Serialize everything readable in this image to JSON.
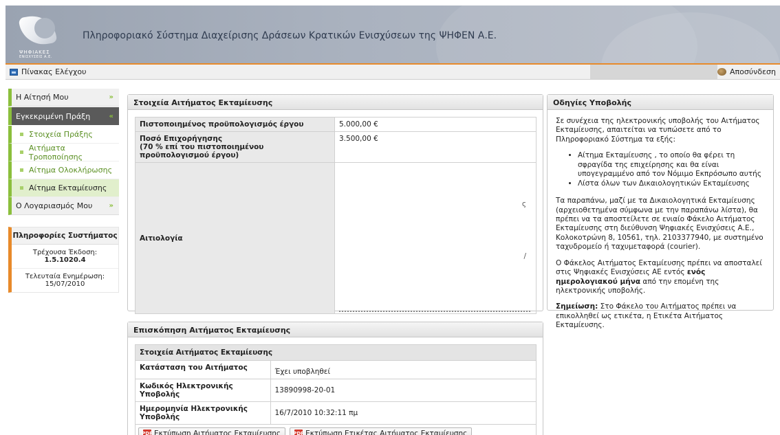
{
  "header": {
    "title": "Πληροφοριακό Σύστημα Διαχείρισης Δράσεων Κρατικών Ενισχύσεων της ΨΗΦΕΝ Α.Ε.",
    "logo_line1": "ΨΗΦΙΑΚΕΣ",
    "logo_line2": "ΕΝΙΣΧΥΣΕΙΣ Α.Ε."
  },
  "navbar": {
    "dashboard": "Πίνακας Ελέγχου",
    "logout": "Αποσύνδεση"
  },
  "sidebar": {
    "items": [
      {
        "label": "Η Αίτησή Μου"
      },
      {
        "label": "Εγκεκριμένη Πράξη"
      },
      {
        "label": "Στοιχεία Πράξης"
      },
      {
        "label": "Αιτήματα Τροποποίησης"
      },
      {
        "label": "Αίτημα Ολοκλήρωσης"
      },
      {
        "label": "Αίτημα Εκταμίευσης"
      },
      {
        "label": "Ο Λογαριασμός Μου"
      }
    ],
    "sysinfo": {
      "title": "Πληροφορίες Συστήματος",
      "version_label": "Τρέχουσα Έκδοση:",
      "version": "1.5.1020.4",
      "updated_label": "Τελευταία Ενημέρωση:",
      "updated": "15/07/2010"
    }
  },
  "disbursement": {
    "title": "Στοιχεία Αιτήματος Εκταμίευσης",
    "rows": [
      {
        "label": "Πιστοποιημένος προϋπολογισμός έργου",
        "value": "5.000,00 €"
      },
      {
        "label": "Ποσό Επιχορήγησης",
        "label2": "(70 % επί του πιστοποιημένου προϋπολογισμού έργου)",
        "value": "3.500,00 €"
      },
      {
        "label": "Αιτιολογία",
        "value": ""
      }
    ]
  },
  "instructions": {
    "title": "Οδηγίες Υποβολής",
    "p1": "Σε συνέχεια της ηλεκτρονικής υποβολής του Αιτήματος Εκταμίευσης, απαιτείται να τυπώσετε από το Πληροφοριακό Σύστημα τα εξής:",
    "li1": "Αίτημα Εκταμίευσης , το οποίο θα φέρει τη σφραγίδα της επιχείρησης και θα είναι υπογεγραμμένο από τον Νόμιμο Εκπρόσωπο αυτής",
    "li2": "Λίστα όλων των Δικαιολογητικών Εκταμίευσης",
    "p2": "Τα παραπάνω, μαζί με τα Δικαιολογητικά Εκταμίευσης (αρχειοθετημένα σύμφωνα με την παραπάνω λίστα), θα πρέπει να τα αποστείλετε σε ενιαίο Φάκελο Αιτήματος Εκταμίευσης στη διεύθυνση Ψηφιακές Ενισχύσεις Α.Ε., Κολοκοτρώνη 8, 10561, τηλ. 2103377940, με συστημένο ταχυδρομείο ή ταχυμεταφορά (courier).",
    "p3_pre": "Ο Φάκελος Αιτήματος Εκταμίευσης πρέπει να αποσταλεί στις Ψηφιακές Ενισχύσεις ΑΕ εντός ",
    "p3_bold": "ενός ημερολογιακού μήνα",
    "p3_post": " από την επομένη της ηλεκτρονικής υποβολής.",
    "note_bold": "Σημείωση:",
    "note": " Στο Φάκελο του Αιτήματος πρέπει να επικολληθεί ως ετικέτα, η Ετικέτα Αιτήματος Εκταμίευσης."
  },
  "review": {
    "title": "Επισκόπηση Αιτήματος Εκταμίευσης",
    "subtitle": "Στοιχεία Αιτήματος Εκταμίευσης",
    "rows": [
      {
        "label": "Κατάσταση του Αιτήματος",
        "value": "Έχει υποβληθεί"
      },
      {
        "label": "Κωδικός Ηλεκτρονικής Υποβολής",
        "value": "13890998-20-01"
      },
      {
        "label": "Ημερομηνία Ηλεκτρονικής Υποβολής",
        "value": "16/7/2010 10:32:11 πμ"
      }
    ],
    "btn_print_request": "Εκτύπωση Αιτήματος Εκταμίευσης",
    "btn_print_label": "Εκτύπωση Ετικέτας Αιτήματος Εκταμίευσης"
  },
  "colors": {
    "accent_green": "#8bbf3c",
    "accent_orange": "#e88a2a"
  }
}
